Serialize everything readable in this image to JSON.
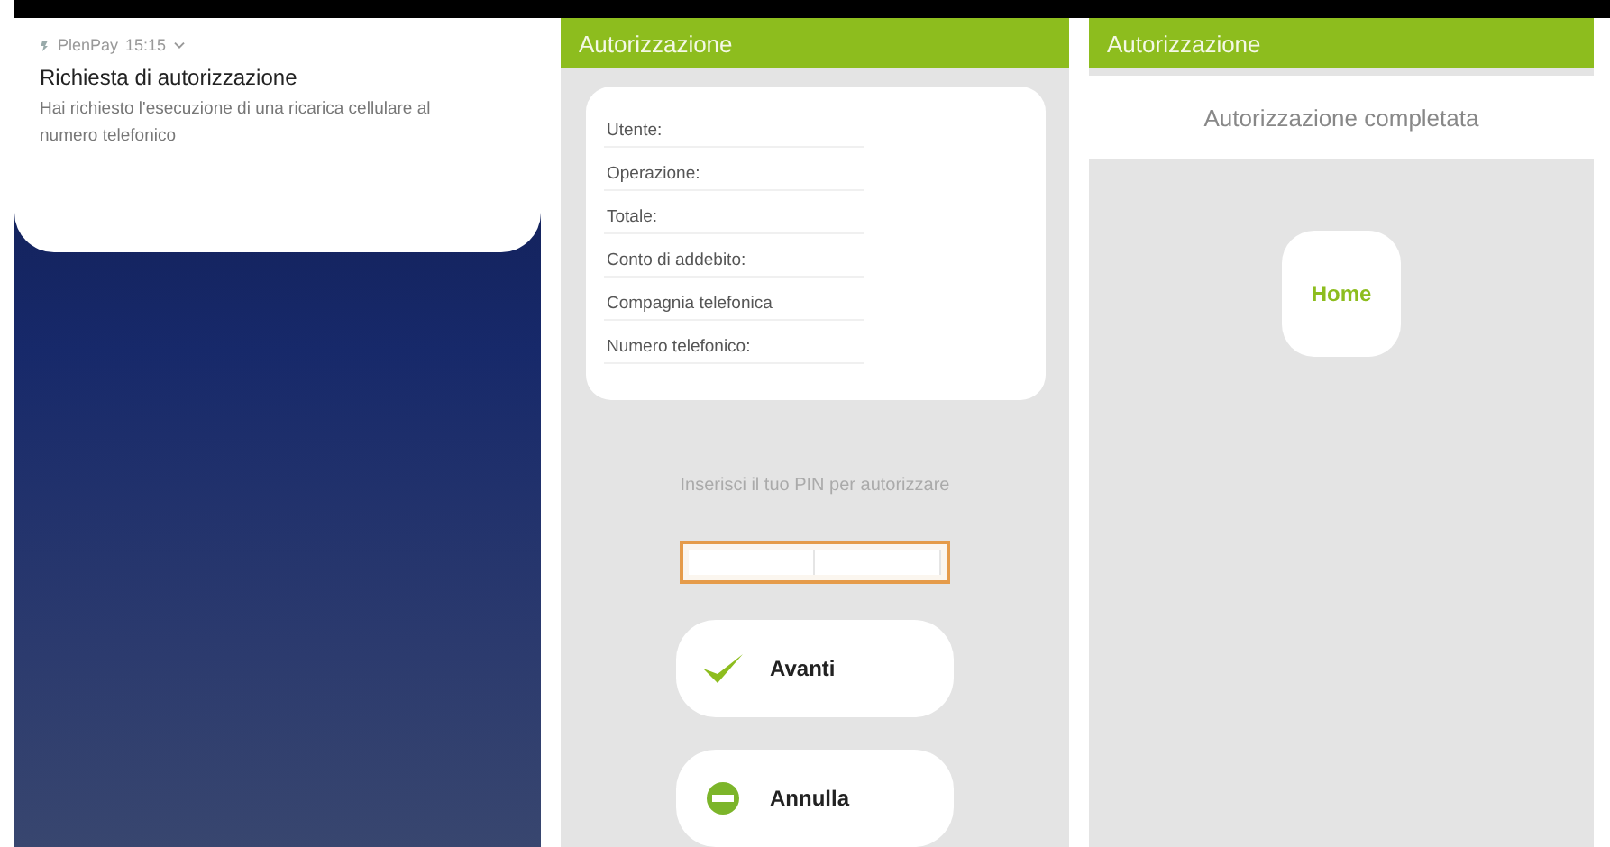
{
  "lock_screen": {
    "notification": {
      "app": "PlenPay",
      "time": "15:15",
      "title": "Richiesta di autorizzazione",
      "body": "Hai richiesto l'esecuzione di una ricarica cellulare al numero telefonico"
    }
  },
  "pin_screen": {
    "header": "Autorizzazione",
    "fields": [
      {
        "label": "Utente:"
      },
      {
        "label": "Operazione:"
      },
      {
        "label": "Totale:"
      },
      {
        "label": "Conto di addebito:"
      },
      {
        "label": "Compagnia telefonica"
      },
      {
        "label": "Numero telefonico:"
      }
    ],
    "pin_prompt": "Inserisci il tuo PIN per autorizzare",
    "buttons": [
      {
        "kind": "confirm",
        "label": "Avanti"
      },
      {
        "kind": "cancel",
        "label": "Annulla"
      }
    ]
  },
  "done_screen": {
    "header": "Autorizzazione",
    "message": "Autorizzazione completata",
    "button": "Home"
  }
}
